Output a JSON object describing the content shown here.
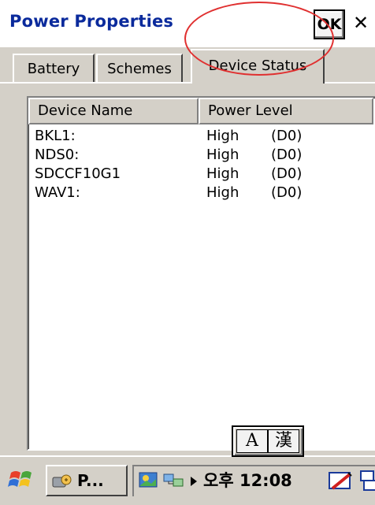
{
  "window": {
    "title": "Power Properties",
    "ok_label": "OK",
    "close_label": "✕"
  },
  "tabs": [
    {
      "label": "Battery",
      "active": false
    },
    {
      "label": "Schemes",
      "active": false
    },
    {
      "label": "Device Status",
      "active": true
    }
  ],
  "list": {
    "columns": [
      "Device Name",
      "Power Level"
    ],
    "rows": [
      {
        "name": "BKL1:",
        "level": "High",
        "state": "(D0)"
      },
      {
        "name": "NDS0:",
        "level": "High",
        "state": "(D0)"
      },
      {
        "name": "SDCCF10G1",
        "level": "High",
        "state": "(D0)"
      },
      {
        "name": "WAV1:",
        "level": "High",
        "state": "(D0)"
      }
    ]
  },
  "ime": {
    "left": "A",
    "right": "漢"
  },
  "taskbar": {
    "task_label": "P...",
    "clock": "오후 12:08"
  },
  "colors": {
    "title_text": "#0a2a9c",
    "face": "#d4d0c8",
    "highlight_circle": "#e03030"
  },
  "icons": [
    "windows-start-icon",
    "power-properties-icon",
    "desktop-icon",
    "network-icon",
    "tray-arrow-icon",
    "input-panel-icon",
    "screens-icon"
  ]
}
